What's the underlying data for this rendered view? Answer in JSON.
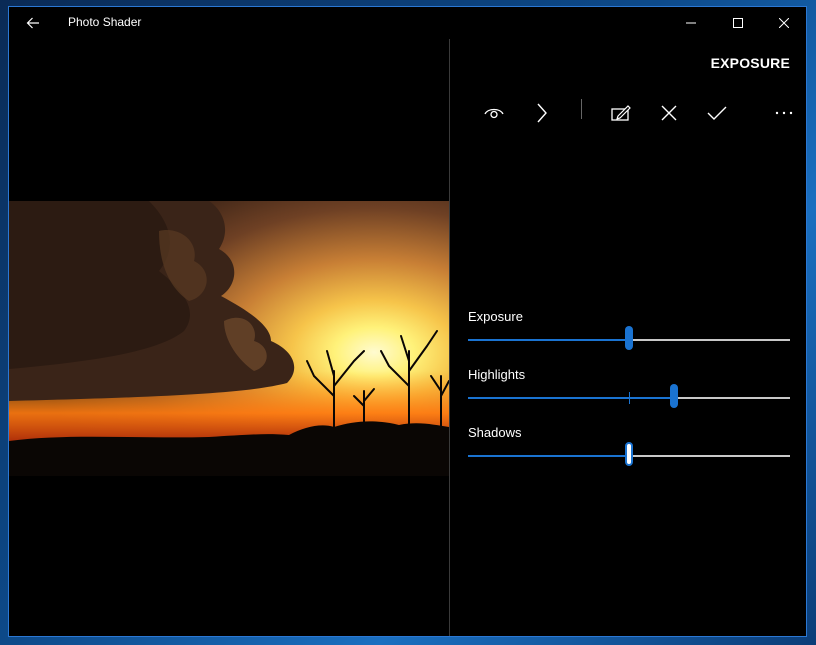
{
  "window": {
    "title": "Photo Shader"
  },
  "panel": {
    "title": "EXPOSURE",
    "toolbar": [
      "eye-icon",
      "chevron-right-icon",
      "edit-icon",
      "close-icon",
      "check-icon",
      "more-icon"
    ]
  },
  "sliders": [
    {
      "label": "Exposure",
      "value": 0.5
    },
    {
      "label": "Highlights",
      "value": 0.64
    },
    {
      "label": "Shadows",
      "value": 0.5
    }
  ],
  "colors": {
    "accent": "#1a73d1",
    "window_border": "#2b78d4"
  }
}
